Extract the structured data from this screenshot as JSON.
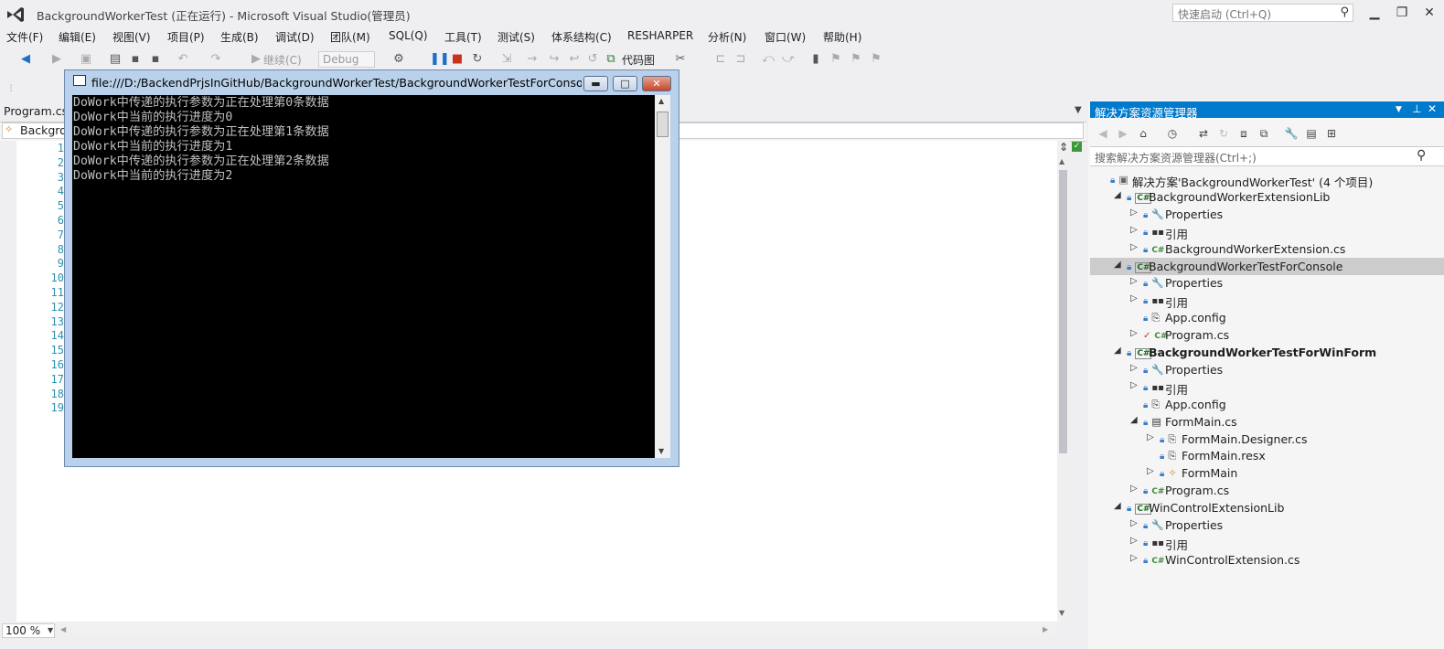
{
  "window": {
    "title": "BackgroundWorkerTest (正在运行) - Microsoft Visual Studio(管理员)",
    "quick_launch_placeholder": "快速启动 (Ctrl+Q)"
  },
  "menu": [
    "文件(F)",
    "编辑(E)",
    "视图(V)",
    "项目(P)",
    "生成(B)",
    "调试(D)",
    "团队(M)",
    "SQL(Q)",
    "工具(T)",
    "测试(S)",
    "体系结构(C)",
    "RESHARPER",
    "分析(N)",
    "窗口(W)",
    "帮助(H)"
  ],
  "toolbar": {
    "continue_label": "继续(C)",
    "config_value": "Debug",
    "codemap_label": "代码图"
  },
  "editor": {
    "tab_label": "Program.cs",
    "nav_text": "Backgro",
    "line_numbers": [
      "1",
      "2",
      "3",
      "4",
      "5",
      "6",
      "7",
      "8",
      "9",
      "10",
      "11",
      "12",
      "13",
      "14",
      "15",
      "16",
      "17",
      "18",
      "19"
    ],
    "zoom": "100 %"
  },
  "console": {
    "title": "file:///D:/BackendPrjsInGitHub/BackgroundWorkerTest/BackgroundWorkerTestForConsole...",
    "lines": [
      "DoWork中传递的执行参数为正在处理第0条数据",
      "DoWork中当前的执行进度为0",
      "DoWork中传递的执行参数为正在处理第1条数据",
      "DoWork中当前的执行进度为1",
      "DoWork中传递的执行参数为正在处理第2条数据",
      "DoWork中当前的执行进度为2"
    ]
  },
  "solution_explorer": {
    "title": "解决方案资源管理器",
    "search_placeholder": "搜索解决方案资源管理器(Ctrl+;)",
    "tree": [
      {
        "label": "解决方案'BackgroundWorkerTest' (4 个项目)"
      },
      {
        "label": "BackgroundWorkerExtensionLib"
      },
      {
        "label": "Properties"
      },
      {
        "label": "引用"
      },
      {
        "label": "BackgroundWorkerExtension.cs"
      },
      {
        "label": "BackgroundWorkerTestForConsole"
      },
      {
        "label": "Properties"
      },
      {
        "label": "引用"
      },
      {
        "label": "App.config"
      },
      {
        "label": "Program.cs"
      },
      {
        "label": "BackgroundWorkerTestForWinForm"
      },
      {
        "label": "Properties"
      },
      {
        "label": "引用"
      },
      {
        "label": "App.config"
      },
      {
        "label": "FormMain.cs"
      },
      {
        "label": "FormMain.Designer.cs"
      },
      {
        "label": "FormMain.resx"
      },
      {
        "label": "FormMain"
      },
      {
        "label": "Program.cs"
      },
      {
        "label": "WinControlExtensionLib"
      },
      {
        "label": "Properties"
      },
      {
        "label": "引用"
      },
      {
        "label": "WinControlExtension.cs"
      }
    ]
  },
  "colors": {
    "accent": "#007acc",
    "line_number": "#2b91af",
    "console_bg": "#000000",
    "console_fg": "#c0c0c0"
  }
}
